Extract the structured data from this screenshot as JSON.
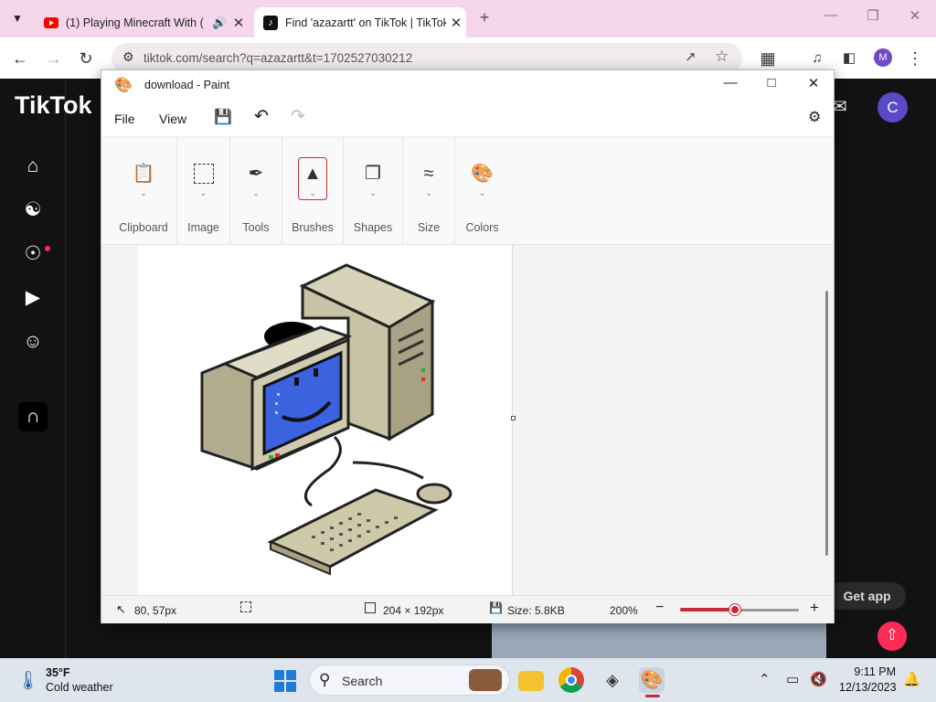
{
  "browser": {
    "tabs": [
      {
        "title": "(1) Playing Minecraft With (",
        "audio_icon": "speaker-icon",
        "favicon": "youtube-icon"
      },
      {
        "title": "Find 'azazartt' on TikTok | TikTok",
        "favicon": "tiktok-icon",
        "active": true
      }
    ],
    "url": "tiktok.com/search?q=azazartt&t=1702527030212",
    "profile_initial": "M"
  },
  "tiktok": {
    "logo": "TikTok",
    "profile_initial": "C",
    "get_app": "Get app",
    "nav_icons": [
      "home-icon",
      "following-icon",
      "explore-icon",
      "live-icon",
      "profile-icon",
      "creator-icon"
    ]
  },
  "paint": {
    "title": "download - Paint",
    "menu": {
      "file": "File",
      "view": "View"
    },
    "ribbon": [
      "Clipboard",
      "Image",
      "Tools",
      "Brushes",
      "Shapes",
      "Size",
      "Colors"
    ],
    "status": {
      "cursor": "80, 57px",
      "dimensions": "204 × 192px",
      "size": "Size: 5.8KB",
      "zoom": "200%"
    },
    "zoom_fraction": 0.46
  },
  "taskbar": {
    "temp": "35°F",
    "weather": "Cold weather",
    "search": "Search",
    "time": "9:11 PM",
    "date": "12/13/2023"
  },
  "colors": {
    "accent_red": "#c42b3b",
    "tiktok_pink": "#fe2c55",
    "chrome_tab_bg": "#f6d6ea",
    "screen_blue": "#3b63e0"
  }
}
